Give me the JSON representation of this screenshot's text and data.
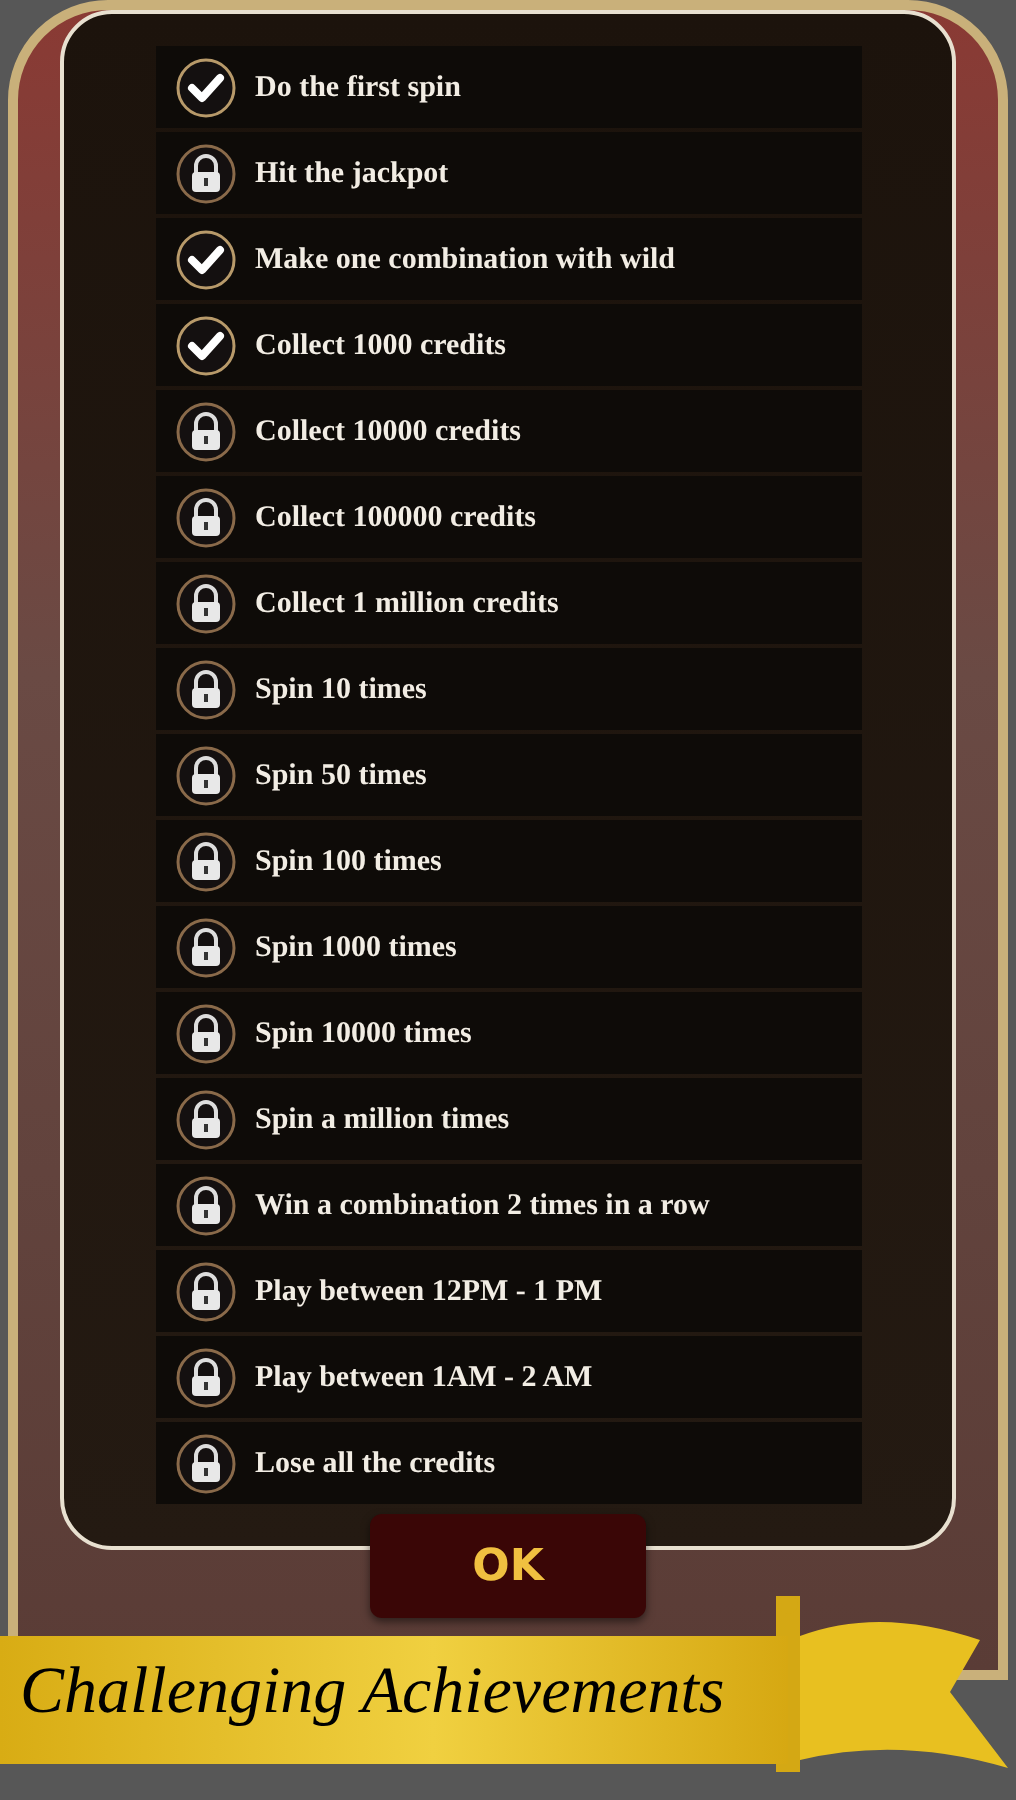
{
  "achievements": [
    {
      "label": "Do the first spin",
      "completed": true
    },
    {
      "label": "Hit the jackpot",
      "completed": false
    },
    {
      "label": "Make one combination with wild",
      "completed": true
    },
    {
      "label": "Collect 1000 credits",
      "completed": true
    },
    {
      "label": "Collect 10000 credits",
      "completed": false
    },
    {
      "label": "Collect 100000 credits",
      "completed": false
    },
    {
      "label": "Collect 1 million credits",
      "completed": false
    },
    {
      "label": "Spin 10 times",
      "completed": false
    },
    {
      "label": "Spin 50 times",
      "completed": false
    },
    {
      "label": "Spin 100 times",
      "completed": false
    },
    {
      "label": "Spin 1000 times",
      "completed": false
    },
    {
      "label": "Spin 10000 times",
      "completed": false
    },
    {
      "label": "Spin a million times",
      "completed": false
    },
    {
      "label": "Win a combination 2 times in a row",
      "completed": false
    },
    {
      "label": "Play between 12PM - 1 PM",
      "completed": false
    },
    {
      "label": "Play between 1AM - 2 AM",
      "completed": false
    },
    {
      "label": "Lose all the credits",
      "completed": false
    }
  ],
  "ok_button": "OK",
  "banner_title": "Challenging Achievements"
}
